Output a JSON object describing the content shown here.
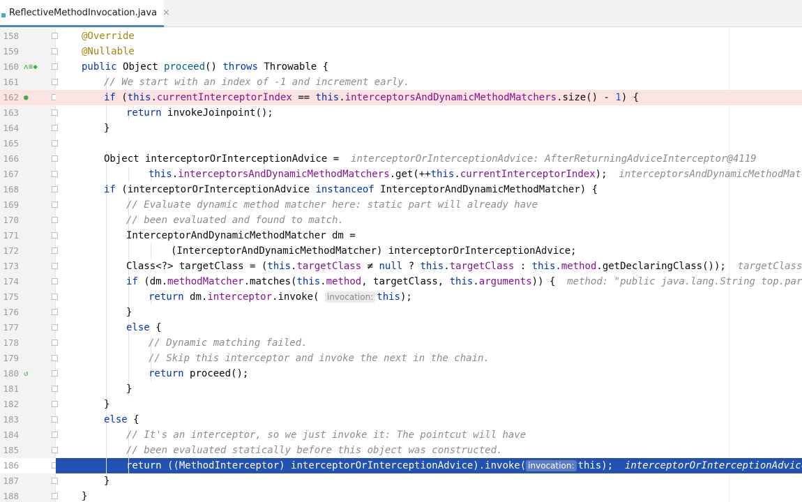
{
  "tab": {
    "label": "ReflectiveMethodInvocation.java",
    "close": "×"
  },
  "lines": [
    {
      "num": "158",
      "indent": 1,
      "tokens": [
        [
          "an",
          "@Override"
        ]
      ]
    },
    {
      "num": "159",
      "indent": 1,
      "tokens": [
        [
          "an",
          "@Nullable"
        ]
      ]
    },
    {
      "num": "160",
      "indent": 1,
      "gicon": "ᴧ≡◆",
      "tokens": [
        [
          "kw",
          "public "
        ],
        [
          "",
          "Object "
        ],
        [
          "mt",
          "proceed"
        ],
        [
          "",
          "() "
        ],
        [
          "kw",
          "throws "
        ],
        [
          "",
          "Throwable {"
        ]
      ]
    },
    {
      "num": "161",
      "indent": 2,
      "tokens": [
        [
          "cm",
          "// We start with an index of -1 and increment early."
        ]
      ]
    },
    {
      "num": "162",
      "indent": 2,
      "hl": "red",
      "gicon": "●",
      "tokens": [
        [
          "kw",
          "if "
        ],
        [
          "",
          "("
        ],
        [
          "kw",
          "this"
        ],
        [
          "",
          "."
        ],
        [
          "fd",
          "currentInterceptorIndex"
        ],
        [
          "",
          " == "
        ],
        [
          "kw",
          "this"
        ],
        [
          "",
          "."
        ],
        [
          "fd",
          "interceptorsAndDynamicMethodMatchers"
        ],
        [
          "",
          ".size() - "
        ],
        [
          "nm",
          "1"
        ],
        [
          "",
          ") {"
        ]
      ]
    },
    {
      "num": "163",
      "indent": 3,
      "tokens": [
        [
          "kw",
          "return "
        ],
        [
          "",
          "invokeJoinpoint();"
        ]
      ]
    },
    {
      "num": "164",
      "indent": 2,
      "tokens": [
        [
          "",
          "}"
        ]
      ]
    },
    {
      "num": "165",
      "indent": 0,
      "tokens": []
    },
    {
      "num": "166",
      "indent": 2,
      "tokens": [
        [
          "",
          "Object interceptorOrInterceptionAdvice =  "
        ],
        [
          "hint",
          "interceptorOrInterceptionAdvice: AfterReturningAdviceInterceptor@4119"
        ]
      ]
    },
    {
      "num": "167",
      "indent": 4,
      "tokens": [
        [
          "kw",
          "this"
        ],
        [
          "",
          "."
        ],
        [
          "fd",
          "interceptorsAndDynamicMethodMatchers"
        ],
        [
          "",
          ".get(++"
        ],
        [
          "kw",
          "this"
        ],
        [
          "",
          "."
        ],
        [
          "fd",
          "currentInterceptorIndex"
        ],
        [
          "",
          ");  "
        ],
        [
          "hint",
          "interceptorsAndDynamicMethodMatchers:"
        ]
      ]
    },
    {
      "num": "168",
      "indent": 2,
      "tokens": [
        [
          "kw",
          "if "
        ],
        [
          "",
          "(interceptorOrInterceptionAdvice "
        ],
        [
          "kw",
          "instanceof "
        ],
        [
          "",
          "InterceptorAndDynamicMethodMatcher) {"
        ]
      ]
    },
    {
      "num": "169",
      "indent": 3,
      "tokens": [
        [
          "cm",
          "// Evaluate dynamic method matcher here: static part will already have"
        ]
      ]
    },
    {
      "num": "170",
      "indent": 3,
      "tokens": [
        [
          "cm",
          "// been evaluated and found to match."
        ]
      ]
    },
    {
      "num": "171",
      "indent": 3,
      "tokens": [
        [
          "",
          "InterceptorAndDynamicMethodMatcher dm ="
        ]
      ]
    },
    {
      "num": "172",
      "indent": 5,
      "tokens": [
        [
          "",
          "(InterceptorAndDynamicMethodMatcher) interceptorOrInterceptionAdvice;"
        ]
      ]
    },
    {
      "num": "173",
      "indent": 3,
      "tokens": [
        [
          "",
          "Class<?> targetClass = ("
        ],
        [
          "kw",
          "this"
        ],
        [
          "",
          "."
        ],
        [
          "fd",
          "targetClass"
        ],
        [
          "",
          " ≠ "
        ],
        [
          "kw",
          "null"
        ],
        [
          "",
          " ? "
        ],
        [
          "kw",
          "this"
        ],
        [
          "",
          "."
        ],
        [
          "fd",
          "targetClass"
        ],
        [
          "",
          " : "
        ],
        [
          "kw",
          "this"
        ],
        [
          "",
          "."
        ],
        [
          "fd",
          "method"
        ],
        [
          "",
          ".getDeclaringClass());  "
        ],
        [
          "hint",
          "targetClass: \"cl"
        ]
      ]
    },
    {
      "num": "174",
      "indent": 3,
      "tokens": [
        [
          "kw",
          "if "
        ],
        [
          "",
          "(dm."
        ],
        [
          "fd",
          "methodMatcher"
        ],
        [
          "",
          ".matches("
        ],
        [
          "kw",
          "this"
        ],
        [
          "",
          "."
        ],
        [
          "fd",
          "method"
        ],
        [
          "",
          ", targetClass, "
        ],
        [
          "kw",
          "this"
        ],
        [
          "",
          "."
        ],
        [
          "fd",
          "arguments"
        ],
        [
          "",
          ")) {  "
        ],
        [
          "hint",
          "method: \"public java.lang.String top.parak.Tar"
        ]
      ]
    },
    {
      "num": "175",
      "indent": 4,
      "tokens": [
        [
          "kw",
          "return "
        ],
        [
          "",
          "dm."
        ],
        [
          "fd",
          "interceptor"
        ],
        [
          "",
          ".invoke( "
        ],
        [
          "ph",
          "invocation:"
        ],
        [
          "kw",
          "this"
        ],
        [
          "",
          ");"
        ]
      ]
    },
    {
      "num": "176",
      "indent": 3,
      "tokens": [
        [
          "",
          "}"
        ]
      ]
    },
    {
      "num": "177",
      "indent": 3,
      "tokens": [
        [
          "kw",
          "else "
        ],
        [
          "",
          "{"
        ]
      ]
    },
    {
      "num": "178",
      "indent": 4,
      "tokens": [
        [
          "cm",
          "// Dynamic matching failed."
        ]
      ]
    },
    {
      "num": "179",
      "indent": 4,
      "tokens": [
        [
          "cm",
          "// Skip this interceptor and invoke the next in the chain."
        ]
      ]
    },
    {
      "num": "180",
      "indent": 4,
      "gicon": "↺",
      "tokens": [
        [
          "kw",
          "return "
        ],
        [
          "",
          "proceed();"
        ]
      ]
    },
    {
      "num": "181",
      "indent": 3,
      "tokens": [
        [
          "",
          "}"
        ]
      ]
    },
    {
      "num": "182",
      "indent": 2,
      "tokens": [
        [
          "",
          "}"
        ]
      ]
    },
    {
      "num": "183",
      "indent": 2,
      "tokens": [
        [
          "kw",
          "else "
        ],
        [
          "",
          "{"
        ]
      ]
    },
    {
      "num": "184",
      "indent": 3,
      "tokens": [
        [
          "cm",
          "// It's an interceptor, so we just invoke it: The pointcut will have"
        ]
      ]
    },
    {
      "num": "185",
      "indent": 3,
      "tokens": [
        [
          "cm",
          "// been evaluated statically before this object was constructed."
        ]
      ]
    },
    {
      "num": "186",
      "indent": 3,
      "hl": "blue",
      "tokens": [
        [
          "kw",
          "return "
        ],
        [
          "",
          "((MethodInterceptor) interceptorOrInterceptionAdvice).invoke("
        ],
        [
          "ph",
          "invocation:"
        ],
        [
          "",
          "this);  "
        ],
        [
          "hint",
          "interceptorOrInterceptionAdvice: Af"
        ]
      ]
    },
    {
      "num": "187",
      "indent": 2,
      "tokens": [
        [
          "",
          "}"
        ]
      ]
    },
    {
      "num": "188",
      "indent": 1,
      "tokens": [
        [
          "",
          "}"
        ]
      ]
    }
  ]
}
